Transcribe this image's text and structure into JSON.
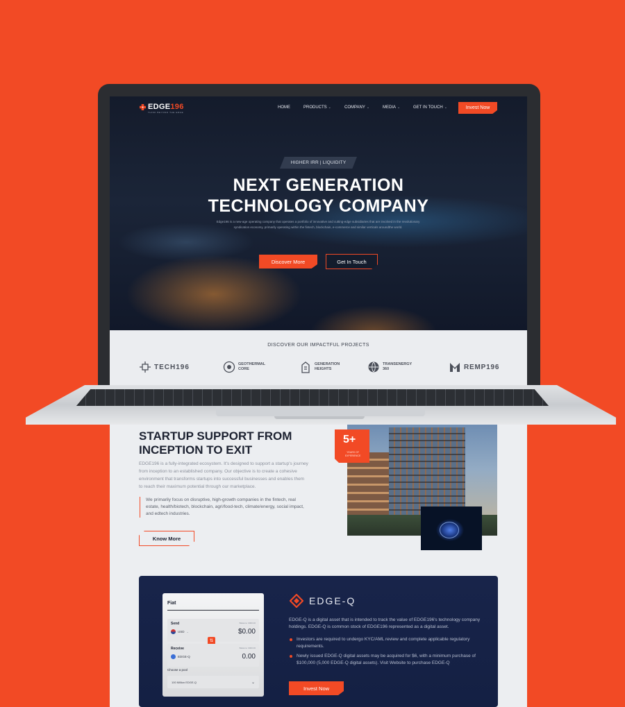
{
  "nav": {
    "logo_main": "EDGE",
    "logo_accent": "196",
    "logo_tagline": "THINK BEYOND THE EDGE",
    "links": [
      "HOME",
      "PRODUCTS",
      "COMPANY",
      "MEDIA",
      "GET IN TOUCH"
    ],
    "cta": "Invest Now"
  },
  "hero": {
    "badge": "HIGHER IRR | LIQUIDITY",
    "title_line1": "NEXT GENERATION",
    "title_line2": "TECHNOLOGY COMPANY",
    "body": "Edge196 is a new-age operating company that operates a portfolio of innovative and cutting-edge subsidiaries that are involved in the revolutionary syndication economy, primarily operating within the fintech, blockchain, e-commerce and similar verticals aroundthe world.",
    "btn_primary": "Discover More",
    "btn_secondary": "Get In Touch"
  },
  "projects": {
    "heading": "DISCOVER OUR IMPACTFUL PROJECTS",
    "logos": [
      {
        "line1": "TECH196",
        "line2": ""
      },
      {
        "line1": "GEOTHERMAL",
        "line2": "CORE"
      },
      {
        "line1": "GENERATION",
        "line2": "HEIGHTS"
      },
      {
        "line1": "TRANSENERGY",
        "line2": "360"
      },
      {
        "line1": "REMP196",
        "line2": ""
      }
    ]
  },
  "startup": {
    "title": "STARTUP SUPPORT FROM INCEPTION TO EXIT",
    "desc": "EDGE196 is a fully-integrated ecosystem. It's designed to support a startup's journey from inception to an established company. Our objective is to create a cohesive environment that transforms startups into successful businesses and enables them to reach their maximum potential through our marketplace.",
    "quote": "We primarily focus on disruptive, high-growth companies in the fintech, real estate, health/biotech, blockchain, agri/food-tech, climate/energy, social impact, and edtech industries.",
    "button": "Know More",
    "exp_num": "5+",
    "exp_label": "YEARS OF EXPERIENCE"
  },
  "widget": {
    "title": "Fiat",
    "send_label": "Send",
    "send_small": "Balance: 0000.00",
    "send_currency": "USD",
    "send_value": "$0.00",
    "receive_label": "Receive",
    "receive_small": "Balance: 0000.00",
    "receive_currency": "EDGE-Q",
    "receive_value": "0.00",
    "pool_label": "Choose a pool",
    "pool_value": "100 Million EDGE-Q"
  },
  "edgeq": {
    "name": "EDGE-Q",
    "desc": "EDGE-Q is a digital asset that is intended to track the value of EDGE196's technology company holdings. EDGE-Q is common stock of EDGE196 represented as a digital asset.",
    "bullets": [
      "Investors are required to undergo KYC/AML review and complete applicable regulatory requirements.",
      "Newly issued EDGE-Q digital assets may be acquired for $6, with a minimum purchase of $100,000 (5,000 EDGE-Q digital assets). Visit Website to purchase EDGE-Q"
    ],
    "button": "Invest Now"
  },
  "colors": {
    "background": "#f24a25",
    "accent": "#f24a25",
    "hero_dark": "#141b2b",
    "card_navy": "#18244a"
  }
}
